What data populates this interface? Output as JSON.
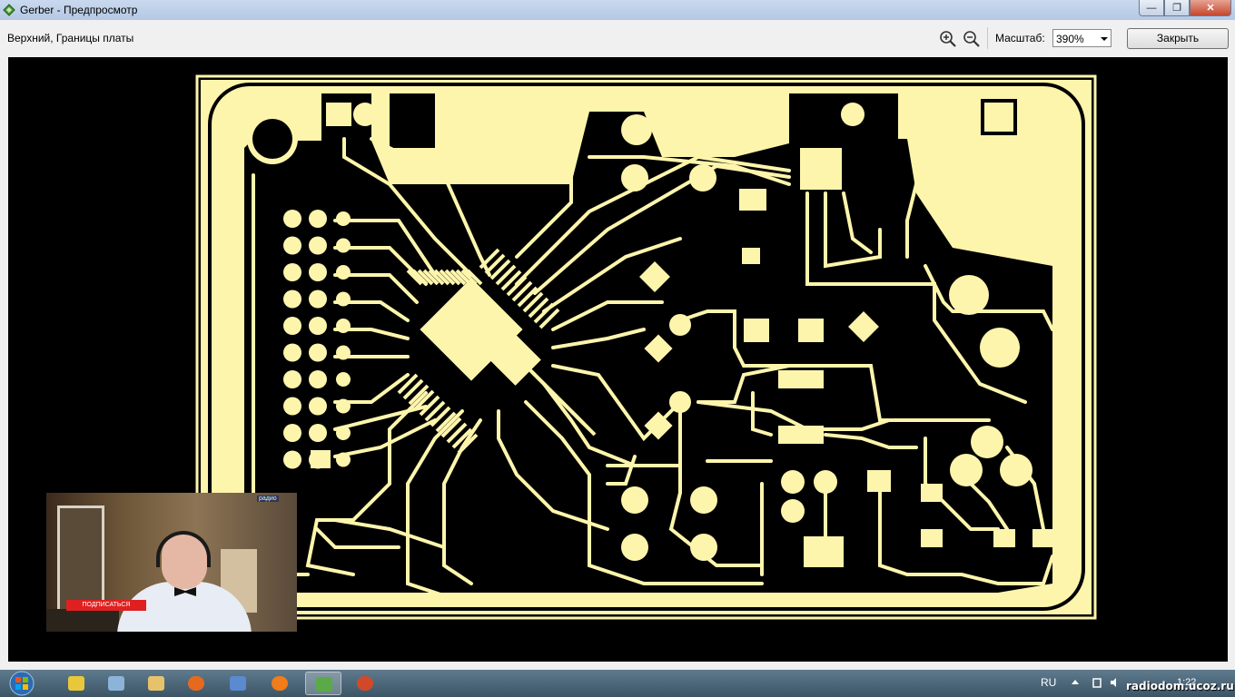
{
  "window": {
    "title": "Gerber - Предпросмотр",
    "controls": {
      "minimize": "—",
      "maximize": "❐",
      "close": "✕"
    }
  },
  "toolbar": {
    "layer_label": "Верхний, Границы платы",
    "zoom_in_icon": "zoom-in-icon",
    "zoom_out_icon": "zoom-out-icon",
    "scale_label": "Масштаб:",
    "scale_value": "390%",
    "close_label": "Закрыть"
  },
  "colors": {
    "board": "#fdf5ac",
    "background": "#000000"
  },
  "webcam": {
    "tag": "радио",
    "subscribe_label": "ПОДПИСАТЬСЯ"
  },
  "taskbar": {
    "language": "RU",
    "time": "1:22",
    "items": [
      "start-icon",
      "paint-icon",
      "computer-icon",
      "folder-icon",
      "firefox-icon",
      "app-icon",
      "vlc-icon",
      "gerber-icon",
      "settings-icon"
    ]
  },
  "watermark": "radiodom.ucoz.ru"
}
